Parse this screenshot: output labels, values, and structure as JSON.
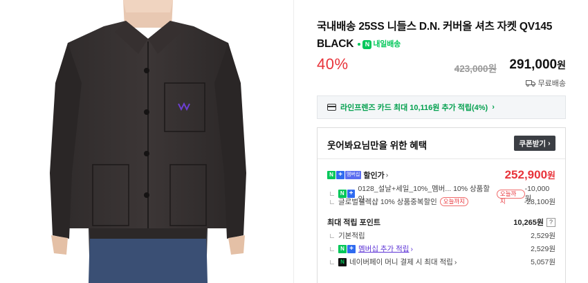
{
  "product": {
    "title": "국내배송 25SS 니들스 D.N. 커버올 셔츠 자켓 QV145 BLACK",
    "tomorrow_label": "내일배송",
    "discount_rate": "40%",
    "original_price": "423,000원",
    "sale_price": "291,000",
    "sale_price_unit": "원",
    "shipping": "무료배송"
  },
  "card_banner": {
    "text": "라인프렌즈 카드 최대 10,116원 추가 적립(4%)",
    "icon": "credit-card-icon"
  },
  "benefit": {
    "title": "웃어봐요님만을 위한 혜택",
    "coupon_button": "쿠폰받기",
    "membership_badge": "멤버십",
    "discount_price_label": "할인가",
    "discount_price": "252,900",
    "discount_price_unit": "원",
    "discounts": [
      {
        "label": "0128_설날+세일_10%_멤버... 10% 상품할인",
        "tag": "오늘까지",
        "amount": "-10,000원"
      },
      {
        "label": "글로벌셀렉샵 10% 상품중복할인",
        "tag": "오늘까지",
        "amount": "-28,100원"
      }
    ],
    "points_label": "최대 적립 포인트",
    "points_value": "10,265원",
    "points_help": "?",
    "points": [
      {
        "label": "기본적립",
        "amount": "2,529원"
      },
      {
        "label": "멤버십 추가 적립",
        "amount": "2,529원"
      },
      {
        "label": "네이버페이 머니 결제 시 최대 적립",
        "amount": "5,057원"
      }
    ]
  },
  "colors": {
    "discount_red": "#e8333a",
    "naver_green": "#03c75a",
    "membership_purple": "#5c33d6"
  }
}
